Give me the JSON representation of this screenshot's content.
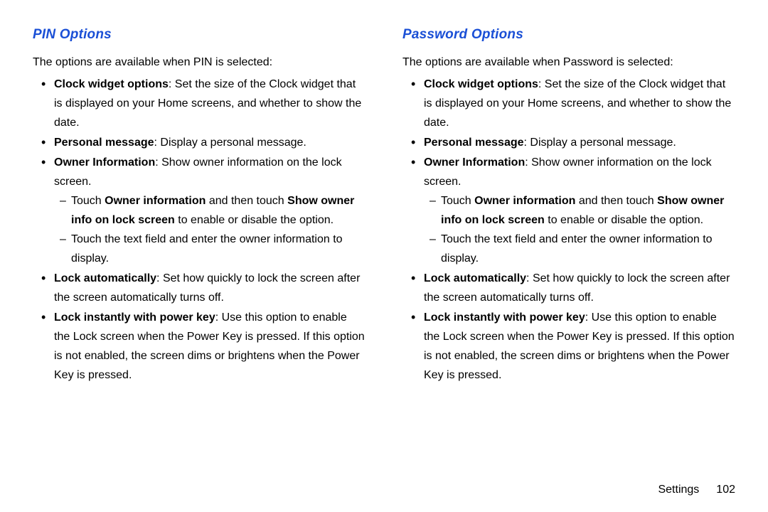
{
  "left": {
    "heading": "PIN Options",
    "intro": "The options are available when PIN is selected:",
    "items": {
      "clock": {
        "label": "Clock widget options",
        "text": ": Set the size of the Clock widget that is displayed on your Home screens, and whether to show the date."
      },
      "personal": {
        "label": "Personal message",
        "text": ": Display a personal message."
      },
      "owner": {
        "label": "Owner Information",
        "text": ": Show owner information on the lock screen."
      },
      "owner_sub1": {
        "pre": "Touch ",
        "b1": "Owner information",
        "mid": " and then touch ",
        "b2": "Show owner info on lock screen",
        "post": " to enable or disable the option."
      },
      "owner_sub2": "Touch the text field and enter the owner information to display.",
      "lockauto": {
        "label": "Lock automatically",
        "text": ": Set how quickly to lock the screen after the screen automatically turns off."
      },
      "lockinstant": {
        "label": "Lock instantly with power key",
        "text": ": Use this option to enable the Lock screen when the Power Key is pressed. If this option is not enabled, the screen dims or brightens when the Power Key is pressed."
      }
    }
  },
  "right": {
    "heading": "Password Options",
    "intro": "The options are available when Password is selected:",
    "items": {
      "clock": {
        "label": "Clock widget options",
        "text": ": Set the size of the Clock widget that is displayed on your Home screens, and whether to show the date."
      },
      "personal": {
        "label": "Personal message",
        "text": ": Display a personal message."
      },
      "owner": {
        "label": "Owner Information",
        "text": ": Show owner information on the lock screen."
      },
      "owner_sub1": {
        "pre": "Touch ",
        "b1": "Owner information",
        "mid": " and then touch ",
        "b2": "Show owner info on lock screen",
        "post": " to enable or disable the option."
      },
      "owner_sub2": "Touch the text field and enter the owner information to display.",
      "lockauto": {
        "label": "Lock automatically",
        "text": ": Set how quickly to lock the screen after the screen automatically turns off."
      },
      "lockinstant": {
        "label": "Lock instantly with power key",
        "text": ": Use this option to enable the Lock screen when the Power Key is pressed. If this option is not enabled, the screen dims or brightens when the Power Key is pressed."
      }
    }
  },
  "footer": {
    "section": "Settings",
    "page": "102"
  }
}
